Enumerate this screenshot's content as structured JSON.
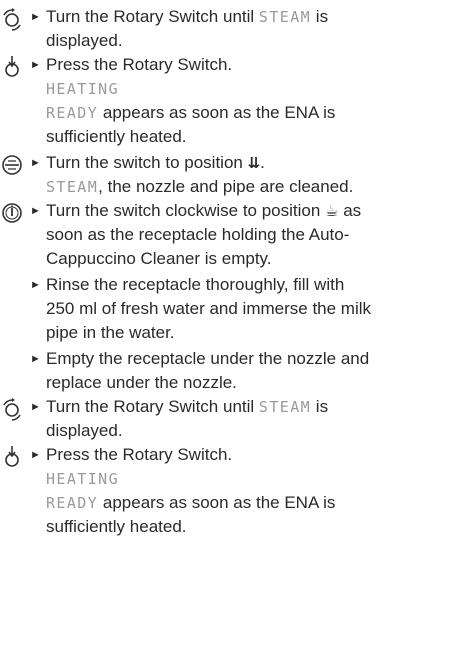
{
  "bullet": "►",
  "steps": [
    {
      "icon": "rotary-turn-icon",
      "lines": [
        {
          "pre": "Turn the Rotary Switch until ",
          "disp": "STEAM",
          "post": " is"
        },
        {
          "text": "displayed."
        }
      ]
    },
    {
      "icon": "rotary-press-icon",
      "lines": [
        {
          "text": "Press the Rotary Switch."
        },
        {
          "disp": "HEATING"
        },
        {
          "disp": "READY",
          "post": " appears as soon as the ENA is"
        },
        {
          "text": "sufficiently heated."
        }
      ]
    },
    {
      "icon": "switch-position-icon",
      "lines": [
        {
          "pre": "Turn the switch to position ",
          "glyph": "⇊",
          "post": "."
        },
        {
          "disp": "STEAM",
          "post": ", the nozzle and pipe are cleaned."
        }
      ]
    },
    {
      "icon": "switch-clockwise-icon",
      "lines": [
        {
          "pre": "Turn the switch clockwise to position ",
          "glyph": "☕",
          "post": " as"
        },
        {
          "text": "soon as the receptacle holding the Auto-"
        },
        {
          "text": "Cappuccino Cleaner is empty."
        }
      ]
    },
    {
      "icon": "",
      "lines": [
        {
          "text": "Rinse the receptacle thoroughly, fill with"
        },
        {
          "text": "250 ml of fresh water and immerse the milk"
        },
        {
          "text": "pipe in the water."
        }
      ]
    },
    {
      "icon": "",
      "lines": [
        {
          "text": "Empty the receptacle under the nozzle and"
        },
        {
          "text": "replace under the nozzle."
        }
      ]
    },
    {
      "icon": "rotary-turn-icon",
      "lines": [
        {
          "pre": "Turn the Rotary Switch until ",
          "disp": "STEAM",
          "post": " is"
        },
        {
          "text": "displayed."
        }
      ]
    },
    {
      "icon": "rotary-press-icon",
      "lines": [
        {
          "text": "Press the Rotary Switch."
        },
        {
          "disp": "HEATING"
        },
        {
          "disp": "READY",
          "post": " appears as soon as the ENA is"
        },
        {
          "text": "sufficiently heated."
        }
      ]
    }
  ]
}
